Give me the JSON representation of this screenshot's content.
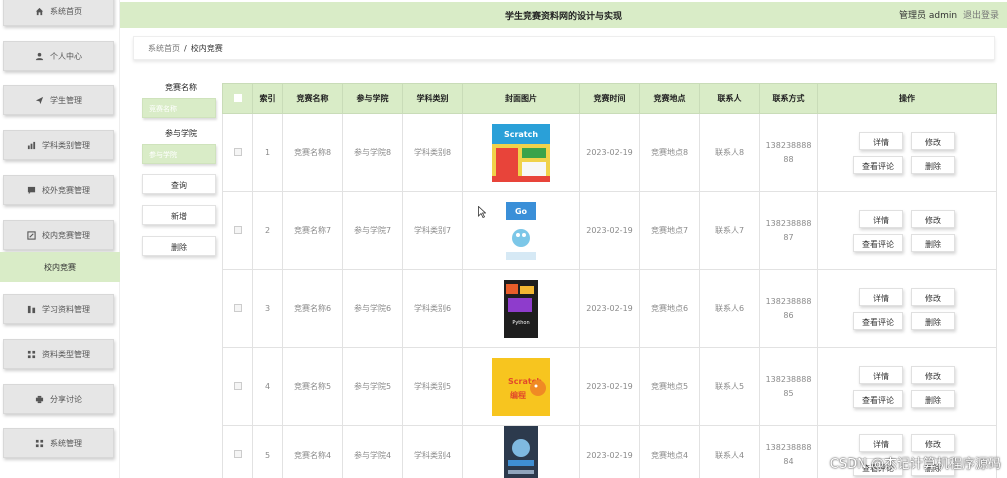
{
  "app": {
    "title": "学生竞赛资料网的设计与实现",
    "user": "管理员 admin",
    "logout": "退出登录"
  },
  "sidebar": {
    "items": [
      {
        "label": "系统首页",
        "icon": "home-icon"
      },
      {
        "label": "个人中心",
        "icon": "user-icon"
      },
      {
        "label": "学生管理",
        "icon": "send-icon"
      },
      {
        "label": "学科类别管理",
        "icon": "chart-icon"
      },
      {
        "label": "校外竞赛管理",
        "icon": "chat-icon"
      },
      {
        "label": "校内竞赛管理",
        "icon": "edit-icon"
      },
      {
        "label": "学习资料管理",
        "icon": "bar-icon"
      },
      {
        "label": "资料类型管理",
        "icon": "grid-icon"
      },
      {
        "label": "分享讨论",
        "icon": "print-icon"
      },
      {
        "label": "系统管理",
        "icon": "grid-icon"
      }
    ],
    "active_sub": "校内竞赛"
  },
  "breadcrumb": {
    "home": "系统首页",
    "separator": "/",
    "current": "校内竞赛"
  },
  "search": {
    "name_label": "竞赛名称",
    "name_placeholder": "竞赛名称",
    "college_label": "参与学院",
    "college_placeholder": "参与学院",
    "query": "查询",
    "add": "新增",
    "delete": "删除"
  },
  "table": {
    "headers": [
      "索引",
      "竞赛名称",
      "参与学院",
      "学科类别",
      "封面图片",
      "竞赛时间",
      "竞赛地点",
      "联系人",
      "联系方式",
      "操作"
    ],
    "actions": {
      "detail": "详情",
      "edit": "修改",
      "comments": "查看评论",
      "delete": "删除"
    },
    "rows": [
      {
        "index": "1",
        "name": "竞赛名称8",
        "college": "参与学院8",
        "category": "学科类别8",
        "time": "2023-02-19",
        "place": "竞赛地点8",
        "contact": "联系人8",
        "phone1": "138238888",
        "phone2": "88"
      },
      {
        "index": "2",
        "name": "竞赛名称7",
        "college": "参与学院7",
        "category": "学科类别7",
        "time": "2023-02-19",
        "place": "竞赛地点7",
        "contact": "联系人7",
        "phone1": "138238888",
        "phone2": "87"
      },
      {
        "index": "3",
        "name": "竞赛名称6",
        "college": "参与学院6",
        "category": "学科类别6",
        "time": "2023-02-19",
        "place": "竞赛地点6",
        "contact": "联系人6",
        "phone1": "138238888",
        "phone2": "86"
      },
      {
        "index": "4",
        "name": "竞赛名称5",
        "college": "参与学院5",
        "category": "学科类别5",
        "time": "2023-02-19",
        "place": "竞赛地点5",
        "contact": "联系人5",
        "phone1": "138238888",
        "phone2": "85"
      },
      {
        "index": "5",
        "name": "竞赛名称4",
        "college": "参与学院4",
        "category": "学科类别4",
        "time": "2023-02-19",
        "place": "竞赛地点4",
        "contact": "联系人4",
        "phone1": "138238888",
        "phone2": "84"
      }
    ]
  },
  "watermark": "CSDN @杰记计算机程序源码",
  "colors": {
    "accent": "#d9ecc7",
    "sidebar_item": "#e6e6e6"
  }
}
